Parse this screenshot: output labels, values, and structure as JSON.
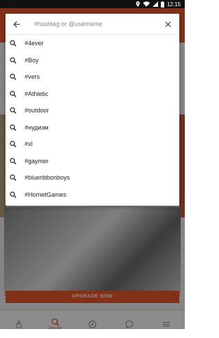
{
  "status_bar": {
    "time": "12:15",
    "icons": [
      "location-icon",
      "wifi-icon",
      "signal-icon",
      "battery-icon"
    ]
  },
  "search": {
    "placeholder": "#hashtag or @username",
    "value": "",
    "back_icon": "arrow-left-icon",
    "clear_icon": "close-icon",
    "result_icon": "search-icon",
    "results": [
      "#4ever",
      "#Boy",
      "#vers",
      "#Athletic",
      "#outdoor",
      "#нудизм",
      "#xl",
      "#gaymer",
      "#blueribbonboys",
      "#HornetGames"
    ]
  },
  "background": {
    "upgrade_label": "UPGRADE NOW",
    "nav": [
      {
        "icon": "flame-icon",
        "label": ""
      },
      {
        "icon": "search-icon",
        "label": "Discover"
      },
      {
        "icon": "compass-icon",
        "label": ""
      },
      {
        "icon": "chat-icon",
        "label": ""
      },
      {
        "icon": "menu-icon",
        "label": ""
      }
    ]
  },
  "colors": {
    "accent": "#ea5a2a",
    "status_bar": "#121212",
    "scrim": "rgba(0,0,0,0.45)"
  }
}
